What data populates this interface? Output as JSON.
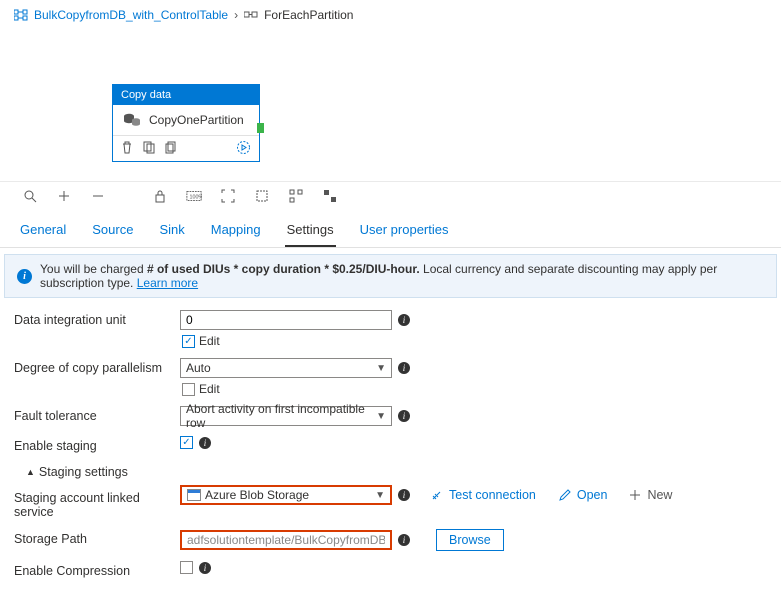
{
  "breadcrumb": {
    "root": "BulkCopyfromDB_with_ControlTable",
    "current": "ForEachPartition"
  },
  "activity": {
    "type_label": "Copy data",
    "name": "CopyOnePartition"
  },
  "tabs": {
    "general": "General",
    "source": "Source",
    "sink": "Sink",
    "mapping": "Mapping",
    "settings": "Settings",
    "user_properties": "User properties"
  },
  "info_bar": {
    "prefix": "You will be charged ",
    "formula": "# of used DIUs * copy duration * $0.25/DIU-hour.",
    "suffix": " Local currency and separate discounting may apply per subscription type. ",
    "link": "Learn more"
  },
  "form": {
    "diu_label": "Data integration unit",
    "diu_value": "0",
    "edit": "Edit",
    "parallel_label": "Degree of copy parallelism",
    "parallel_value": "Auto",
    "fault_label": "Fault tolerance",
    "fault_value": "Abort activity on first incompatible row",
    "staging_label": "Enable staging",
    "staging_settings": "Staging settings",
    "linked_label": "Staging account linked service",
    "linked_value": "Azure Blob Storage",
    "test_conn": "Test connection",
    "open": "Open",
    "new": "New",
    "path_label": "Storage Path",
    "path_value": "adfsolutiontemplate/BulkCopyfromDB_with_Co",
    "browse": "Browse",
    "compress_label": "Enable Compression"
  }
}
